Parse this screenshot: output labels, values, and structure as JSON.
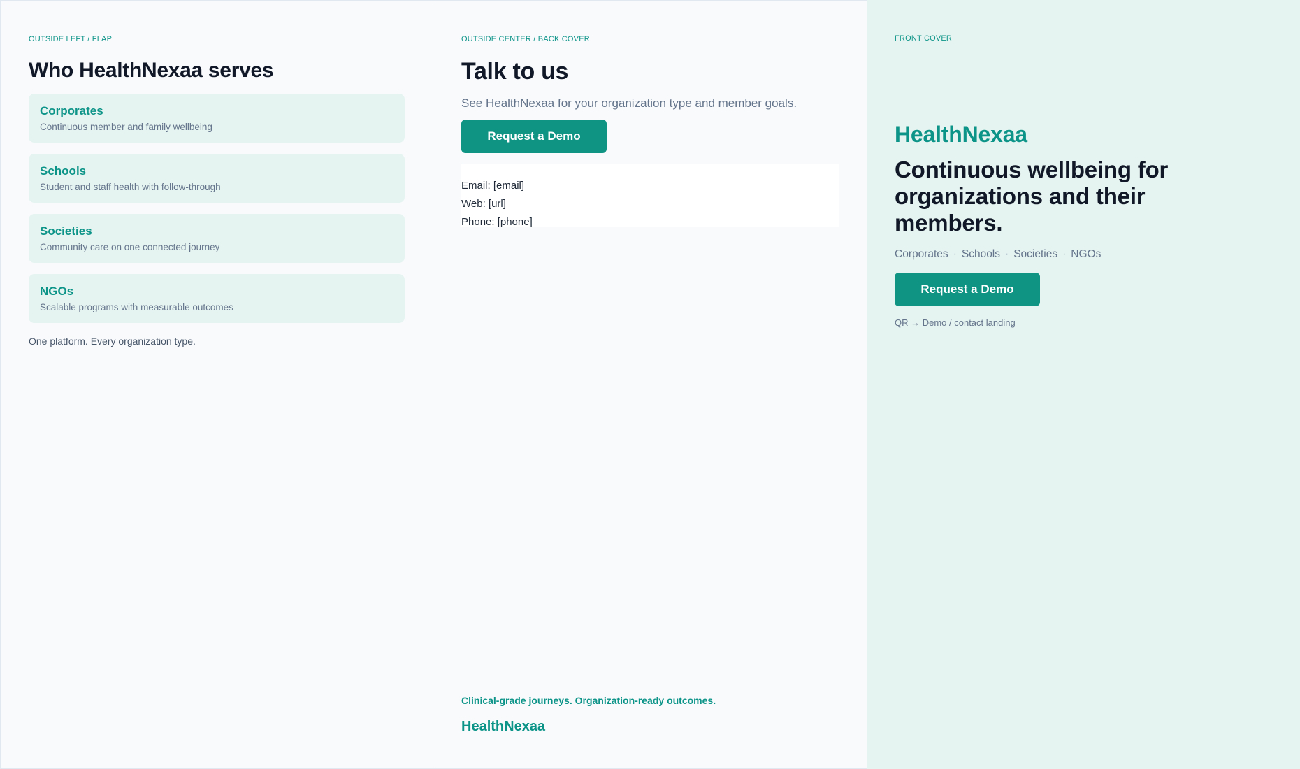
{
  "left": {
    "eyebrow": "OUTSIDE LEFT / FLAP",
    "heading": "Who HealthNexaa serves",
    "segments": [
      {
        "name": "Corporates",
        "desc": "Continuous member and family wellbeing"
      },
      {
        "name": "Schools",
        "desc": "Student and staff health with follow-through"
      },
      {
        "name": "Societies",
        "desc": "Community care on one connected journey"
      },
      {
        "name": "NGOs",
        "desc": "Scalable programs with measurable outcomes"
      }
    ],
    "tagline": "One platform. Every organization type."
  },
  "center": {
    "eyebrow": "OUTSIDE CENTER / BACK COVER",
    "heading": "Talk to us",
    "subheading": "See HealthNexaa for your organization type and member goals.",
    "button_label": "Request a Demo",
    "contact": {
      "email": "Email: [email]",
      "web": "Web: [url]",
      "phone": "Phone: [phone]"
    },
    "footer_tagline": "Clinical-grade journeys. Organization-ready outcomes.",
    "footer_brand": "HealthNexaa"
  },
  "right": {
    "eyebrow": "FRONT COVER",
    "brand": "HealthNexaa",
    "headline": "Continuous wellbeing for organizations and their members.",
    "segments": [
      "Corporates",
      "Schools",
      "Societies",
      "NGOs"
    ],
    "separator": "·",
    "button_label": "Request a Demo",
    "qr_note": "QR → Demo / contact landing"
  },
  "colors": {
    "accent": "#0d9488",
    "button": "#0f9383",
    "cover_bg": "#e6f4f1",
    "page_bg": "#f8fafc"
  }
}
